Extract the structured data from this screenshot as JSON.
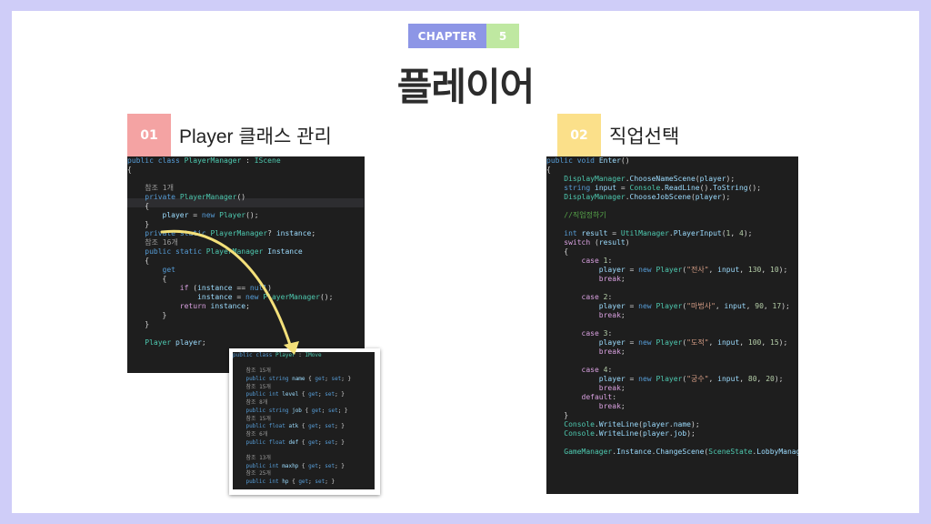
{
  "chapter": {
    "label": "CHAPTER",
    "number": "5"
  },
  "title": "플레이어",
  "sections": [
    {
      "number": "01",
      "title": "Player 클래스 관리",
      "color": "#f4a3a3"
    },
    {
      "number": "02",
      "title": "직업선택",
      "color": "#fbe08a"
    }
  ],
  "code_left": [
    "public class PlayerManager : IScene",
    "{",
    "",
    "    참조 1개",
    "    private PlayerManager()",
    "    {",
    "        player = new Player();",
    "    }",
    "    private static PlayerManager? instance;",
    "    참조 16개",
    "    public static PlayerManager Instance",
    "    {",
    "        get",
    "        {",
    "            if (instance == null)",
    "                instance = new PlayerManager();",
    "            return instance;",
    "        }",
    "    }",
    "",
    "    Player player;"
  ],
  "code_popup": [
    "public class Player : IMove",
    "",
    "    참조 15개",
    "    public string name { get; set; }",
    "    참조 15개",
    "    public int level { get; set; }",
    "    참조 8개",
    "    public string job { get; set; }",
    "    참조 15개",
    "    public float atk { get; set; }",
    "    참조 6개",
    "    public float def { get; set; }",
    "",
    "    참조 13개",
    "    public int maxhp { get; set; }",
    "    참조 25개",
    "    public int hp { get; set; }"
  ],
  "code_right": [
    "public void Enter()",
    "{",
    "    DisplayManager.ChooseNameScene(player);",
    "    string input = Console.ReadLine().ToString();",
    "    DisplayManager.ChooseJobScene(player);",
    "",
    "    //직업정하기",
    "",
    "    int result = UtilManager.PlayerInput(1, 4);",
    "    switch (result)",
    "    {",
    "        case 1:",
    "            player = new Player(\"전사\", input, 130, 10);",
    "            break;",
    "",
    "        case 2:",
    "            player = new Player(\"마법사\", input, 90, 17);",
    "            break;",
    "",
    "        case 3:",
    "            player = new Player(\"도적\", input, 100, 15);",
    "            break;",
    "",
    "        case 4:",
    "            player = new Player(\"궁수\", input, 80, 20);",
    "            break;",
    "        default:",
    "            break;",
    "    }",
    "    Console.WriteLine(player.name);",
    "    Console.WriteLine(player.job);",
    "",
    "    GameManager.Instance.ChangeScene(SceneState.LobbyManager);"
  ],
  "colors": {
    "background": "#cfcdf8",
    "chapter_label_bg": "#8d96e6",
    "chapter_number_bg": "#bfe8a1",
    "code_bg": "#1e1e1e",
    "arrow": "#f3e07a"
  }
}
